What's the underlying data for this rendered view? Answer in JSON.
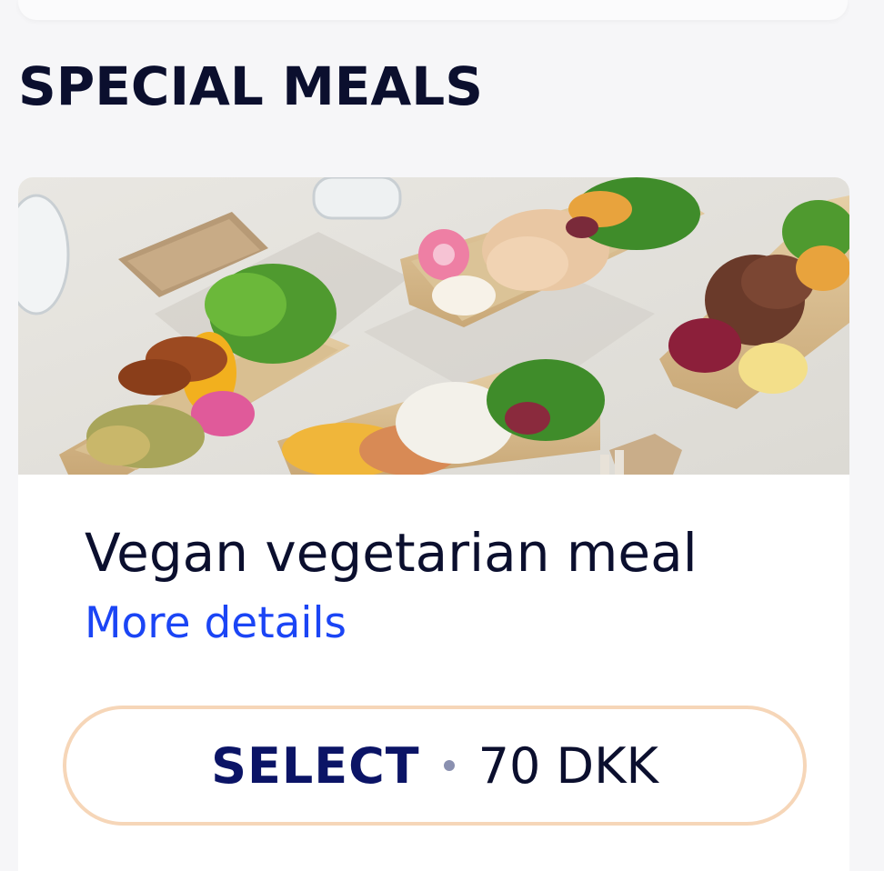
{
  "section": {
    "title": "SPECIAL MEALS"
  },
  "meal": {
    "name": "Vegan vegetarian meal",
    "more_details_label": "More details",
    "image_alt": "Meal trays with salad, sliced chicken, beef, fish and vegetables",
    "select_label": "SELECT",
    "price": "70 DKK"
  },
  "colors": {
    "title_text": "#0b0f2e",
    "link": "#1b45f5",
    "button_border": "#f6d6b8",
    "button_label": "#0b1466"
  }
}
